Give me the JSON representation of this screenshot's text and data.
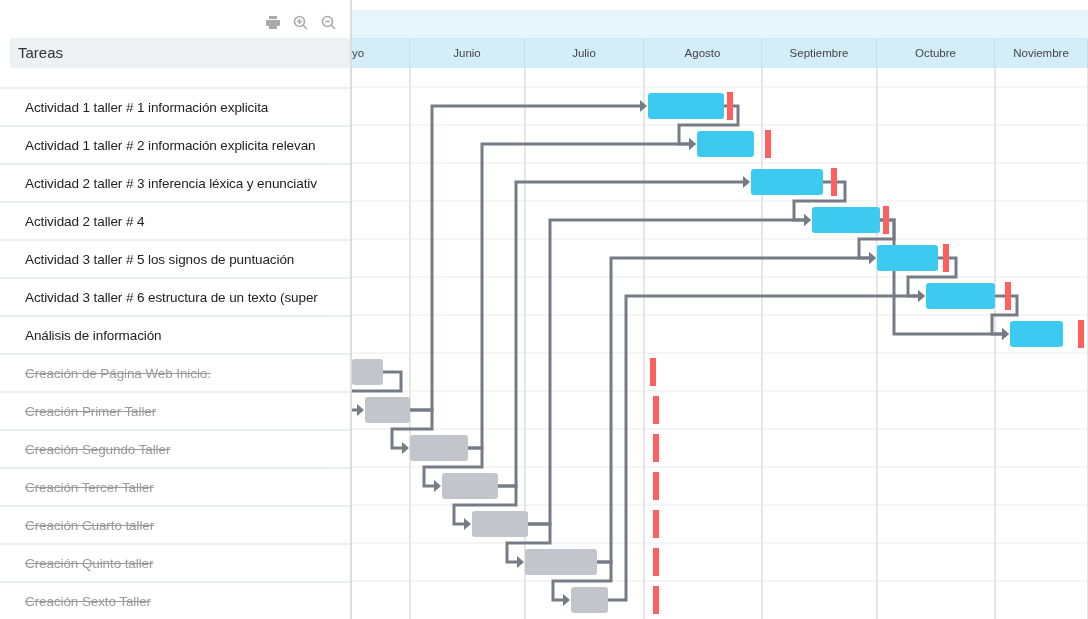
{
  "grid": {
    "header": "Tareas"
  },
  "scale": {
    "months": [
      "yo",
      "Junio",
      "Julio",
      "Agosto",
      "Septiembre",
      "Octubre",
      "Noviembre"
    ]
  },
  "tasks": [
    {
      "name": "Actividad 1 taller # 1 información explicita",
      "done": false
    },
    {
      "name": "Actividad 1 taller # 2 información explicita relevan",
      "done": false
    },
    {
      "name": "Actividad 2 taller # 3 inferencia léxica y enunciativ",
      "done": false
    },
    {
      "name": "Actividad 2 taller # 4",
      "done": false
    },
    {
      "name": "Actividad 3 taller # 5 los signos de puntuación",
      "done": false
    },
    {
      "name": "Actividad 3 taller # 6 estructura de un texto (super",
      "done": false
    },
    {
      "name": "Análisis de información",
      "done": false
    },
    {
      "name": "Creación de Página Web Inicio.",
      "done": true
    },
    {
      "name": "Creación Primer Taller",
      "done": true
    },
    {
      "name": "Creación Segundo Taller",
      "done": true
    },
    {
      "name": "Creación Tercer Taller",
      "done": true
    },
    {
      "name": "Creación Cuarto taller",
      "done": true
    },
    {
      "name": "Creación Quinto taller",
      "done": true
    },
    {
      "name": "Creación Sexto Taller",
      "done": true
    }
  ]
}
